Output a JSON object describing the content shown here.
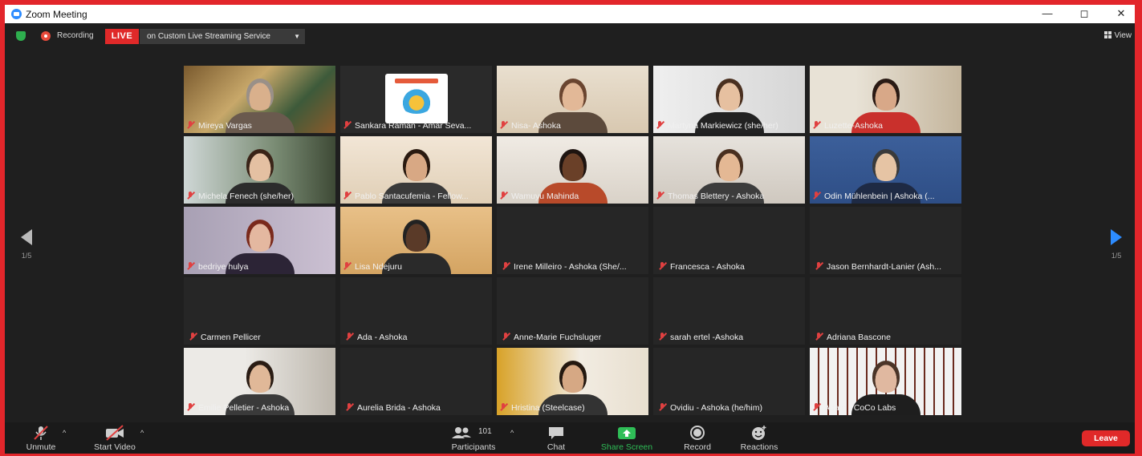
{
  "window": {
    "title": "Zoom Meeting"
  },
  "status": {
    "recording_label": "Recording",
    "live_badge": "LIVE",
    "stream_label": "on Custom Live Streaming Service",
    "view_label": "View"
  },
  "pager": {
    "left": "1/5",
    "right": "1/5"
  },
  "participants": [
    {
      "name": "Mireya Vargas"
    },
    {
      "name": "Sankara Raman - Amar Seva..."
    },
    {
      "name": "Nisa- Ashoka"
    },
    {
      "name": "Martyna Markiewicz (she/her)"
    },
    {
      "name": "Luzette-Ashoka"
    },
    {
      "name": "Michela Fenech (she/her)"
    },
    {
      "name": "Pablo Santacufemia - Fellow..."
    },
    {
      "name": "Wamuyu Mahinda"
    },
    {
      "name": "Thomas Blettery - Ashoka"
    },
    {
      "name": "Odin Mühlenbein | Ashoka (..."
    },
    {
      "name": "bedriye hulya"
    },
    {
      "name": "Lisa Ndejuru"
    },
    {
      "name": "Irene Milleiro - Ashoka (She/..."
    },
    {
      "name": "Francesca - Ashoka"
    },
    {
      "name": "Jason Bernhardt-Lanier (Ash..."
    },
    {
      "name": "Carmen Pellicer"
    },
    {
      "name": "Ada - Ashoka"
    },
    {
      "name": "Anne-Marie Fuchsluger"
    },
    {
      "name": "sarah ertel -Ashoka"
    },
    {
      "name": "Adriana Bascone"
    },
    {
      "name": "Emilie Pelletier - Ashoka"
    },
    {
      "name": "Aurelia Brida - Ashoka"
    },
    {
      "name": "Hristina (Steelcase)"
    },
    {
      "name": "Ovidiu - Ashoka (he/him)"
    },
    {
      "name": "Adam - CoCo Labs"
    }
  ],
  "toolbar": {
    "unmute": "Unmute",
    "start_video": "Start Video",
    "participants": "Participants",
    "participants_count": "101",
    "chat": "Chat",
    "share_screen": "Share Screen",
    "record": "Record",
    "reactions": "Reactions",
    "leave": "Leave"
  },
  "colors": {
    "frame": "#e2262b",
    "window_bg": "#1f1f1f",
    "accent": "#2d8cff",
    "live": "#e02929",
    "share": "#2fbe57",
    "active_speaker": "#d7e76a"
  }
}
